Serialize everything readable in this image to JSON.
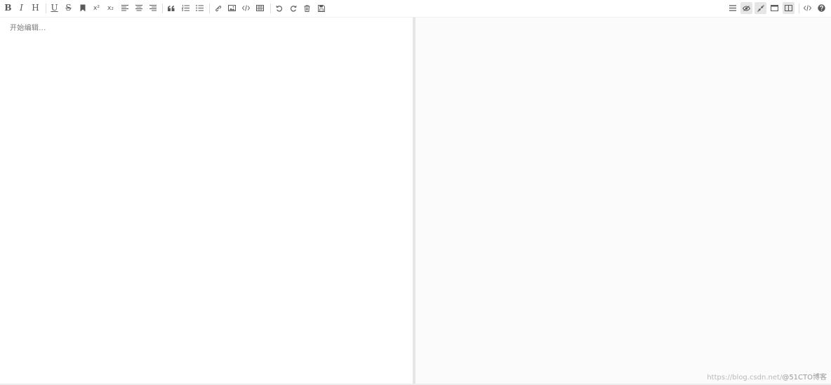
{
  "toolbar": {
    "left": {
      "bold_glyph": "B",
      "italic_glyph": "I",
      "heading_glyph": "H",
      "underline_glyph": "U",
      "strikethrough_glyph": "S",
      "superscript_glyph": "x²",
      "subscript_glyph": "x₂"
    },
    "right": {
      "preview_active": true,
      "sync_scroll_active": true,
      "subfield_active": true
    }
  },
  "icons": [
    "bold-icon",
    "italic-icon",
    "heading-icon",
    "underline-icon",
    "strikethrough-icon",
    "mark-icon",
    "superscript-icon",
    "subscript-icon",
    "align-left-icon",
    "align-center-icon",
    "align-right-icon",
    "quote-icon",
    "ordered-list-icon",
    "unordered-list-icon",
    "link-icon",
    "image-icon",
    "code-icon",
    "table-icon",
    "undo-icon",
    "redo-icon",
    "trash-icon",
    "save-icon",
    "navigation-icon",
    "preview-icon",
    "sync-scroll-icon",
    "fullscreen-icon",
    "subfield-icon",
    "html-code-icon",
    "help-icon"
  ],
  "editor": {
    "placeholder": "开始编辑..."
  },
  "watermark": {
    "url": "https://blog.csdn.net/",
    "brand": "@51CTO博客"
  },
  "colors": {
    "toolbar_icon": "#595959",
    "active_button_bg": "#e6e6e6",
    "divider": "#e6e6e6",
    "preview_bg": "#fbfbfb"
  }
}
